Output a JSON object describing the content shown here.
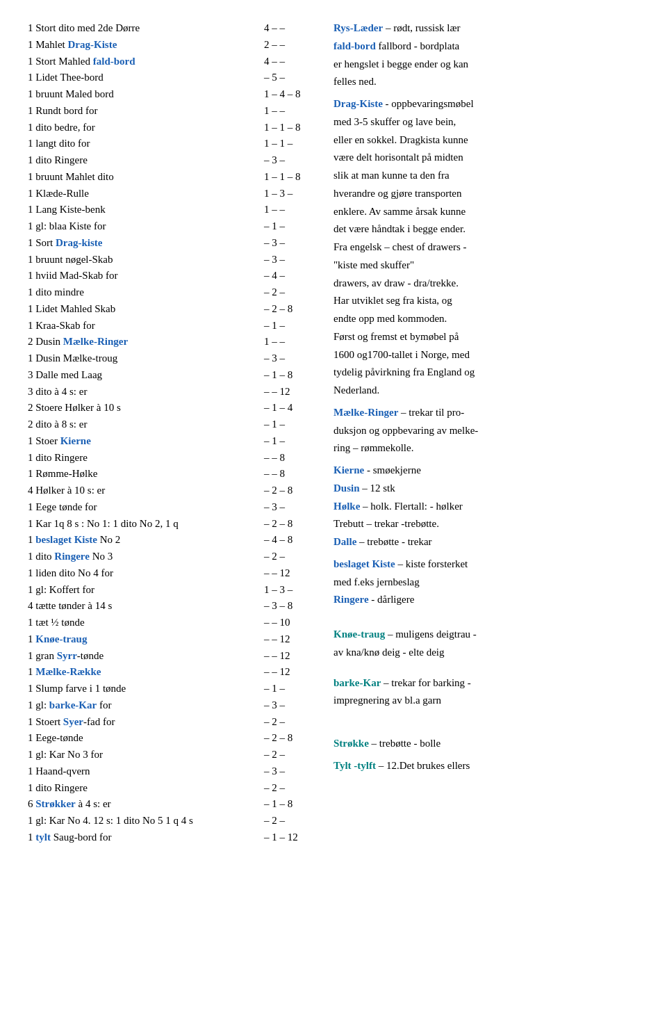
{
  "left": [
    {
      "text": "1 Stort dito med 2de Dørre",
      "nums": "4 – \"–\""
    },
    {
      "text": "1 Mahlet [Drag-Kiste]",
      "nums": "2 – \"–\"",
      "highlight": "Drag-Kiste"
    },
    {
      "text": "1 Stort Mahled [fald-bord]",
      "nums": "4 – \"–\"",
      "highlight": "fald-bord"
    },
    {
      "text": "1 Lidet Thee-bord",
      "nums": "\"–\" 5 \"–\""
    },
    {
      "text": "1 bruunt Maled bord",
      "nums": "1 – 4 – 8"
    },
    {
      "text": "1 Rundt bord for",
      "nums": "1 – \"–\""
    },
    {
      "text": "1 dito bedre, for",
      "nums": "1 – 1 – 8"
    },
    {
      "text": "1 langt dito for",
      "nums": "1 – 1 \"–\""
    },
    {
      "text": "1 dito Ringere",
      "nums": "\"–\" 3 \"–\""
    },
    {
      "text": "1 bruunt Mahlet dito",
      "nums": "1 – 1 – 8"
    },
    {
      "text": "1 Klæde-Rulle",
      "nums": "1 – 3 \"–\""
    },
    {
      "text": "1 Lang Kiste-benk",
      "nums": "1 – \"–\""
    },
    {
      "text": "1 gl: blaa Kiste for",
      "nums": "\"–\" 1 \"–\""
    },
    {
      "text": "1 Sort [Drag-kiste]",
      "nums": "\"–\" 3 \"–\"",
      "highlight": "Drag-kiste"
    },
    {
      "text": "1 bruunt nøgel-Skab",
      "nums": "\"–\" 3 \"–\""
    },
    {
      "text": "1 hviid Mad-Skab for",
      "nums": "\"–\" 4 \"–\""
    },
    {
      "text": "1 dito mindre",
      "nums": "\"–\" 2 \"–\""
    },
    {
      "text": "1 Lidet Mahled Skab",
      "nums": "\"–\" 2 – 8"
    },
    {
      "text": "1 Kraa-Skab for",
      "nums": "\"–\" 1 \"–\""
    },
    {
      "text": "2 Dusin [Mælke-Ringer]",
      "nums": "1 – \"–\"",
      "highlight": "Mælke-Ringer"
    },
    {
      "text": "1 Dusin Mælke-troug",
      "nums": "\"–\" 3 \"–\""
    },
    {
      "text": "3 Dalle med Laag",
      "nums": "\"–\" 1 – 8"
    },
    {
      "text": "3 dito à 4 s: er",
      "nums": "\"–\" \"–\" 12"
    },
    {
      "text": "2 Stoere Hølker à 10 s",
      "nums": "\"–\" 1 – 4"
    },
    {
      "text": "2 dito à 8 s: er",
      "nums": "\"–\" 1 \"–\""
    },
    {
      "text": "1 Stoer [Kierne]",
      "nums": "\"–\" 1 \"–\"",
      "highlight": "Kierne"
    },
    {
      "text": "1 dito Ringere",
      "nums": "\"–\" \"–\" 8"
    },
    {
      "text": "1 Rømme-Hølke",
      "nums": "\"–\" \"–\" 8"
    },
    {
      "text": "4 Hølker à 10 s: er",
      "nums": "\"–\" 2 – 8"
    },
    {
      "text": "1 Eege tønde for",
      "nums": "\"–\" 3 \"–\""
    },
    {
      "text": "1 Kar 1q 8 s : No 1: 1 dito No 2, 1 q",
      "nums": "\"–\" 2 – 8"
    },
    {
      "text": "1 [beslaget Kiste] No 2",
      "nums": "\"–\" 4 – 8",
      "highlight": "beslaget Kiste"
    },
    {
      "text": "1 dito [Ringere] No 3",
      "nums": "\"–\" 2 \"–\"",
      "highlight": "Ringere"
    },
    {
      "text": "1 liden dito No 4 for",
      "nums": "\"–\" \"–\" 12"
    },
    {
      "text": "1 gl: Koffert for",
      "nums": "1 – 3 \"–\""
    },
    {
      "text": "4 tætte tønder à 14 s",
      "nums": "\"–\" 3 – 8"
    },
    {
      "text": "1 tæt ½ tønde",
      "nums": "\"–\" \"–\" 10"
    },
    {
      "text": "1 [Knøe-traug]",
      "nums": "\"–\" \"–\" 12",
      "highlight": "Knøe-traug"
    },
    {
      "text": "1 gran [Syrr]-tønde",
      "nums": "\"–\" \"–\" 12",
      "highlight": "Syrr"
    },
    {
      "text": "1 [Mælke-Række]",
      "nums": "\"–\" \"–\" 12",
      "highlight": "Mælke-Række"
    },
    {
      "text": "1 Slump farve i 1 tønde",
      "nums": "\"–\" 1 \"–\""
    },
    {
      "text": "1 gl: [barke-Kar] for",
      "nums": "\"–\" 3 \"–\"",
      "highlight": "barke-Kar"
    },
    {
      "text": "1 Stoert [Syer]-fad for",
      "nums": "\"–\" 2 \"–\"",
      "highlight": "Syer"
    },
    {
      "text": "1 Eege-tønde",
      "nums": "\"–\" 2 – 8"
    },
    {
      "text": "1 gl: Kar No 3 for",
      "nums": "\"–\" 2 \"–\""
    },
    {
      "text": "1 Haand-qvern",
      "nums": "\"–\" 3 \"–\""
    },
    {
      "text": "1 dito Ringere",
      "nums": "\"–\" 2 \"–\""
    },
    {
      "text": "6 [Strøkker] à 4 s: er",
      "nums": "\"–\" 1 – 8",
      "highlight": "Strøkker"
    },
    {
      "text": "1 gl: Kar No 4. 12 s: 1 dito No 5 1 q 4 s",
      "nums": "\"–\" 2 \"–\""
    },
    {
      "text": "1 [tylt] Saug-bord for",
      "nums": "\"–\" 1 – 12",
      "highlight": "tylt"
    }
  ],
  "right": [
    {
      "lines": [
        {
          "text": "[Rys-Læder]",
          "bold": true,
          "color": "blue",
          "suffix": " – rødt, russisk lær"
        }
      ]
    },
    {
      "lines": [
        {
          "text": "[fald-bord]",
          "bold": true,
          "color": "blue",
          "suffix": " fallbord - bordplata"
        }
      ]
    },
    {
      "lines": [
        {
          "text": "",
          "suffix": "er hengslet i begge ender og kan"
        }
      ]
    },
    {
      "lines": [
        {
          "text": "",
          "suffix": "felles ned."
        }
      ]
    },
    {
      "spacer": true
    },
    {
      "lines": [
        {
          "text": "[Drag-Kiste]",
          "bold": true,
          "color": "blue",
          "suffix": " - oppbevaringsmøbel"
        }
      ]
    },
    {
      "lines": [
        {
          "text": "",
          "suffix": "med 3-5 skuffer og lave bein,"
        }
      ]
    },
    {
      "lines": [
        {
          "text": "",
          "suffix": "eller en sokkel. Dragkista kunne"
        }
      ]
    },
    {
      "lines": [
        {
          "text": "",
          "suffix": "være delt horisontalt på midten"
        }
      ]
    },
    {
      "lines": [
        {
          "text": "",
          "suffix": "slik at man kunne ta den fra"
        }
      ]
    },
    {
      "lines": [
        {
          "text": "",
          "suffix": "hverandre og gjøre transporten"
        }
      ]
    },
    {
      "lines": [
        {
          "text": "",
          "suffix": "enklere. Av samme årsak kunne"
        }
      ]
    },
    {
      "lines": [
        {
          "text": "",
          "suffix": "det være håndtak i begge ender."
        }
      ]
    },
    {
      "lines": [
        {
          "text": "",
          "suffix": "Fra engelsk – chest of drawers -"
        }
      ]
    },
    {
      "lines": [
        {
          "text": "",
          "suffix": " \"kiste med skuffer\""
        }
      ]
    },
    {
      "lines": [
        {
          "text": "",
          "suffix": "drawers, av draw - dra/trekke."
        }
      ]
    },
    {
      "lines": [
        {
          "text": "",
          "suffix": "Har utviklet seg fra kista, og"
        }
      ]
    },
    {
      "lines": [
        {
          "text": "",
          "suffix": "endte opp med kommoden."
        }
      ]
    },
    {
      "lines": [
        {
          "text": "",
          "suffix": "Først og fremst et bymøbel på"
        }
      ]
    },
    {
      "lines": [
        {
          "text": "",
          "suffix": "1600 og1700-tallet i Norge, med"
        }
      ]
    },
    {
      "lines": [
        {
          "text": "",
          "suffix": "tydelig påvirkning fra England og"
        }
      ]
    },
    {
      "lines": [
        {
          "text": "",
          "suffix": "Nederland."
        }
      ]
    },
    {
      "spacer": true
    },
    {
      "lines": [
        {
          "text": "[Mælke-Ringer]",
          "bold": true,
          "color": "blue",
          "suffix": " – trekar til pro-"
        }
      ]
    },
    {
      "lines": [
        {
          "text": "",
          "suffix": "duksjon og oppbevaring av melke-"
        }
      ]
    },
    {
      "lines": [
        {
          "text": "",
          "suffix": "ring – rømmekolle."
        }
      ]
    },
    {
      "spacer": true
    },
    {
      "lines": [
        {
          "text": "[Kierne]",
          "bold": true,
          "color": "blue",
          "suffix": " - smøekjerne"
        }
      ]
    },
    {
      "lines": [
        {
          "text": "[Dusin]",
          "bold": true,
          "color": "blue",
          "suffix": " – 12 stk"
        }
      ]
    },
    {
      "lines": [
        {
          "text": "[Hølke]",
          "bold": true,
          "color": "blue",
          "suffix": " – holk. Flertall: - hølker"
        }
      ]
    },
    {
      "lines": [
        {
          "text": "Trebutt",
          "bold": false,
          "color": "black",
          "suffix": " – trekar -trebøtte."
        }
      ]
    },
    {
      "lines": [
        {
          "text": "[Dalle]",
          "bold": true,
          "color": "blue",
          "suffix": " – trebøtte - trekar"
        }
      ]
    },
    {
      "spacer": true
    },
    {
      "lines": [
        {
          "text": "[beslaget Kiste]",
          "bold": true,
          "color": "blue",
          "suffix": " – kiste forsterket"
        }
      ]
    },
    {
      "lines": [
        {
          "text": "",
          "suffix": "med f.eks jernbeslag"
        }
      ]
    },
    {
      "lines": [
        {
          "text": "[Ringere]",
          "bold": true,
          "color": "blue",
          "suffix": " - dårligere"
        }
      ]
    },
    {
      "spacer": true
    },
    {
      "spacer": true
    },
    {
      "spacer": true
    },
    {
      "spacer": true
    },
    {
      "lines": [
        {
          "text": "[Knøe-traug]",
          "bold": true,
          "color": "teal",
          "suffix": " – muligens deigtrau -"
        }
      ]
    },
    {
      "lines": [
        {
          "text": "",
          "suffix": "av kna/knø deig - elte deig"
        }
      ]
    },
    {
      "spacer": true
    },
    {
      "spacer": true
    },
    {
      "spacer": true
    },
    {
      "lines": [
        {
          "text": "[barke-Kar]",
          "bold": true,
          "color": "teal",
          "suffix": " – trekar for barking -"
        }
      ]
    },
    {
      "lines": [
        {
          "text": "",
          "suffix": "impregnering av bl.a garn"
        }
      ]
    },
    {
      "spacer": true
    },
    {
      "spacer": true
    },
    {
      "spacer": true
    },
    {
      "spacer": true
    },
    {
      "spacer": true
    },
    {
      "spacer": true
    },
    {
      "lines": [
        {
          "text": "[Strøkke]",
          "bold": true,
          "color": "teal",
          "suffix": " – trebøtte - bolle"
        }
      ]
    },
    {
      "spacer": true
    },
    {
      "lines": [
        {
          "text": "[Tylt -tylft]",
          "bold": true,
          "color": "teal",
          "suffix": " – 12.Det brukes ellers"
        }
      ]
    }
  ]
}
